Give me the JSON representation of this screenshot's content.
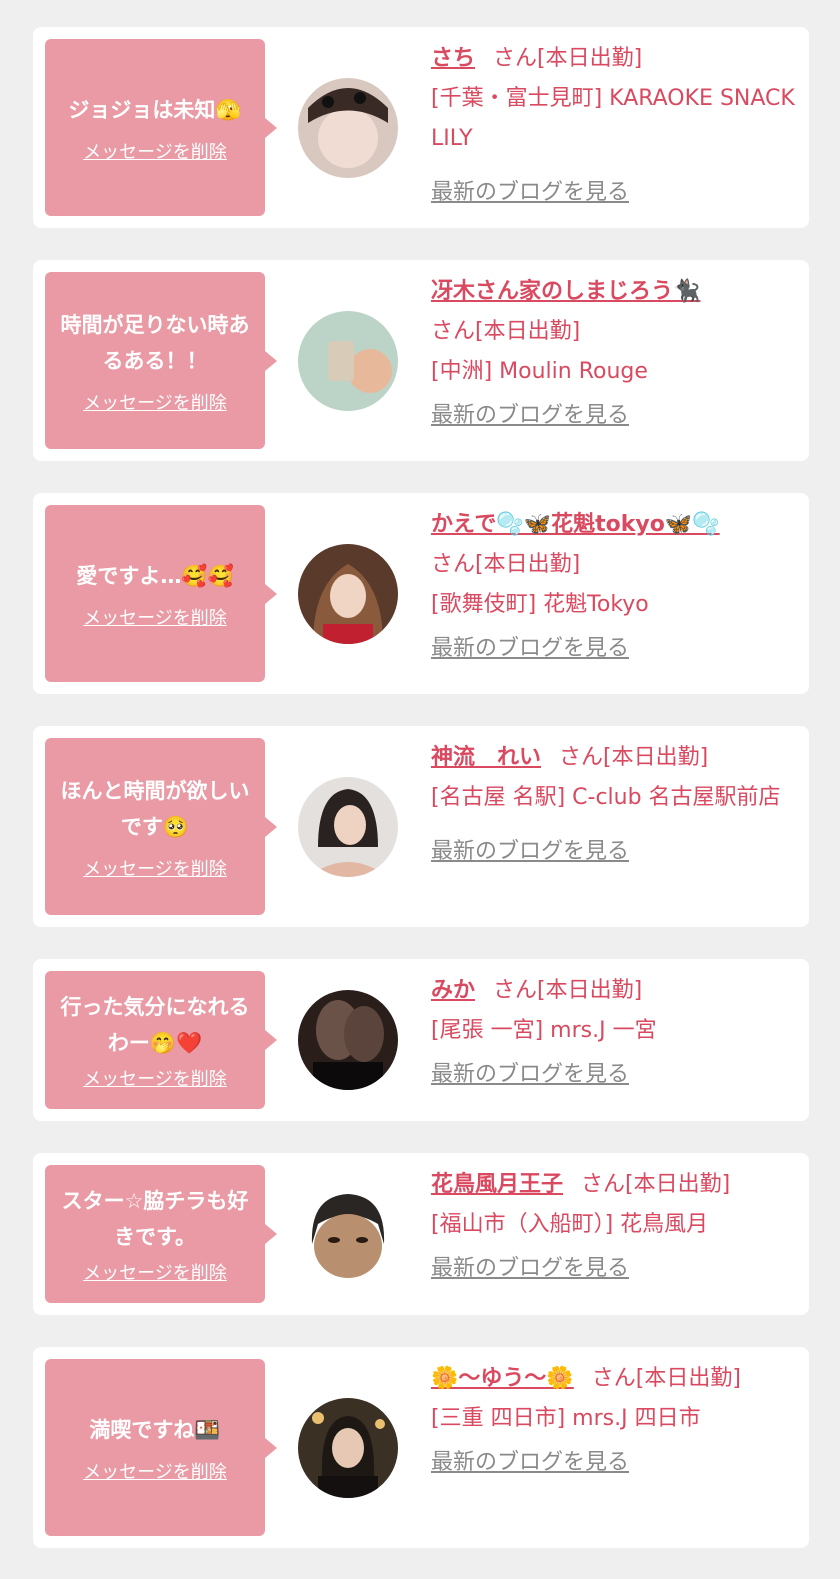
{
  "theme": {
    "accent": "#d94a60",
    "bubble": "#e99aa4",
    "background": "#efefef",
    "card": "#ffffff",
    "link_gray": "#8a8a8a"
  },
  "items": [
    {
      "message": "ジョジョは未知🫣",
      "delete_label": "メッセージを削除",
      "name": "さち",
      "status": "さん[本日出勤]",
      "shop": "[千葉・富士見町] KARAOKE SNACK LILY",
      "blog_label": "最新のブログを見る",
      "avatar_icon": "avatar-photo"
    },
    {
      "message": "時間が足りない時あるある！！",
      "delete_label": "メッセージを削除",
      "name": "冴木さん家のしまじろう🐈‍⬛",
      "status": "さん[本日出勤]",
      "shop": "[中洲] Moulin Rouge",
      "blog_label": "最新のブログを見る",
      "avatar_icon": "avatar-photo"
    },
    {
      "message": "愛ですよ…🥰🥰",
      "delete_label": "メッセージを削除",
      "name": "かえで🫧🦋花魁tokyo🦋🫧",
      "status": "さん[本日出勤]",
      "shop": "[歌舞伎町] 花魁Tokyo",
      "blog_label": "最新のブログを見る",
      "avatar_icon": "avatar-photo"
    },
    {
      "message": "ほんと時間が欲しいです🥺",
      "delete_label": "メッセージを削除",
      "name": "神流　れい",
      "status": "さん[本日出勤]",
      "shop": "[名古屋 名駅] C-club 名古屋駅前店",
      "blog_label": "最新のブログを見る",
      "avatar_icon": "avatar-photo"
    },
    {
      "message": "行った気分になれるわー🤭❤️",
      "delete_label": "メッセージを削除",
      "name": "みか",
      "status": "さん[本日出勤]",
      "shop": "[尾張 一宮] mrs.J 一宮",
      "blog_label": "最新のブログを見る",
      "avatar_icon": "avatar-photo"
    },
    {
      "message": "スター☆脇チラも好きです。",
      "delete_label": "メッセージを削除",
      "name": "花鳥風月王子",
      "status": "さん[本日出勤]",
      "shop": "[福山市（入船町）] 花鳥風月",
      "blog_label": "最新のブログを見る",
      "avatar_icon": "avatar-photo"
    },
    {
      "message": "満喫ですね🍱",
      "delete_label": "メッセージを削除",
      "name": "🌼〜ゆう〜🌼",
      "status": "さん[本日出勤]",
      "shop": "[三重 四日市] mrs.J 四日市",
      "blog_label": "最新のブログを見る",
      "avatar_icon": "avatar-photo"
    }
  ]
}
